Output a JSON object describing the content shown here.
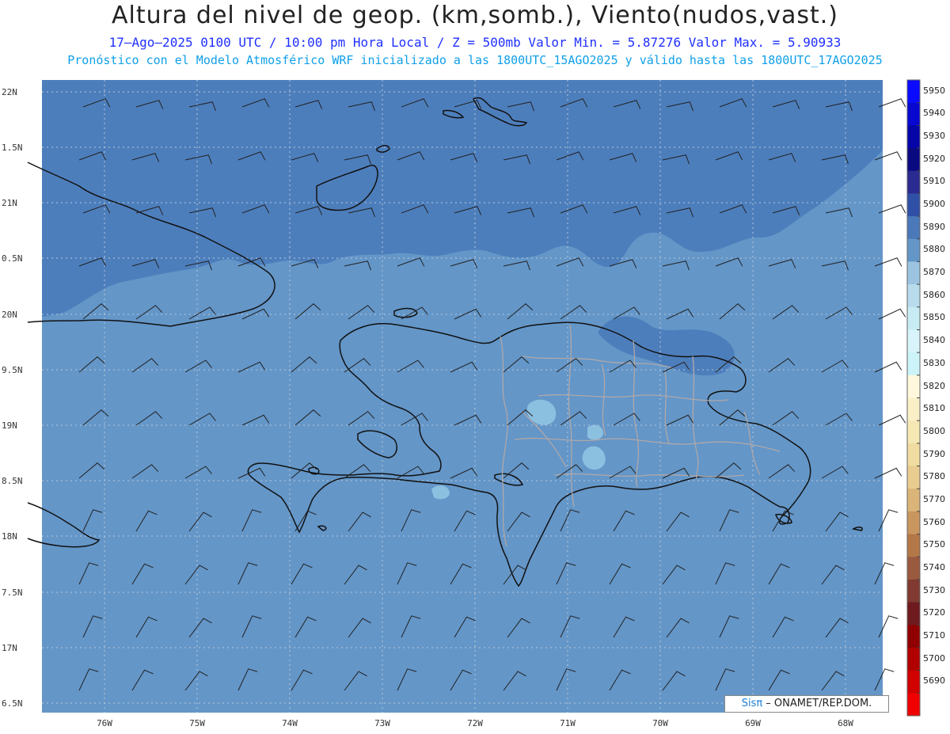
{
  "header": {
    "title": "Altura del nivel de geop. (km,somb.), Viento(nudos,vast.)",
    "line2": "17–Ago–2025  0100 UTC / 10:00 pm Hora Local / Z = 500mb   Valor Min. = 5.87276  Valor Max. = 5.90933",
    "line3": "Pronóstico con el Modelo Atmosférico WRF inicializado a las 1800UTC_15AGO2025 y válido hasta las  1800UTC_17AGO2025"
  },
  "axes": {
    "lat_labels": [
      "22N",
      "1.5N",
      "21N",
      "0.5N",
      "20N",
      "9.5N",
      "19N",
      "8.5N",
      "18N",
      "7.5N",
      "17N",
      "6.5N"
    ],
    "lon_labels": [
      "76W",
      "75W",
      "74W",
      "73W",
      "72W",
      "71W",
      "70W",
      "69W",
      "68W"
    ]
  },
  "colorbar": {
    "labels": [
      "5950",
      "5940",
      "5930",
      "5920",
      "5910",
      "5900",
      "5890",
      "5880",
      "5870",
      "5860",
      "5850",
      "5840",
      "5830",
      "5820",
      "5810",
      "5800",
      "5790",
      "5780",
      "5770",
      "5760",
      "5750",
      "5740",
      "5730",
      "5720",
      "5710",
      "5700",
      "5690"
    ],
    "colors": [
      "#0a0aff",
      "#0808d0",
      "#0505a8",
      "#0a0a80",
      "#2a2a90",
      "#3050a8",
      "#4a78b8",
      "#6496c8",
      "#9cc4e0",
      "#b8dcec",
      "#c8ecf4",
      "#d8f4fa",
      "#ccf4f8",
      "#fff8dc",
      "#faf0c8",
      "#f6e8b4",
      "#f0dca0",
      "#e8cc90",
      "#dab478",
      "#c8965e",
      "#b47848",
      "#9a5a40",
      "#803a32",
      "#6e1a1e",
      "#900000",
      "#b00000",
      "#d00000",
      "#f00000"
    ]
  },
  "colors": {
    "ocean_dark": "#4d7ebc",
    "ocean_main": "#6496c8",
    "light_patch": "#8cc0e0",
    "coast": "#111111",
    "border": "#b0a8a8"
  },
  "credit": {
    "sis": "Sisπ",
    "rest": " – ONAMET/REP.DOM."
  }
}
